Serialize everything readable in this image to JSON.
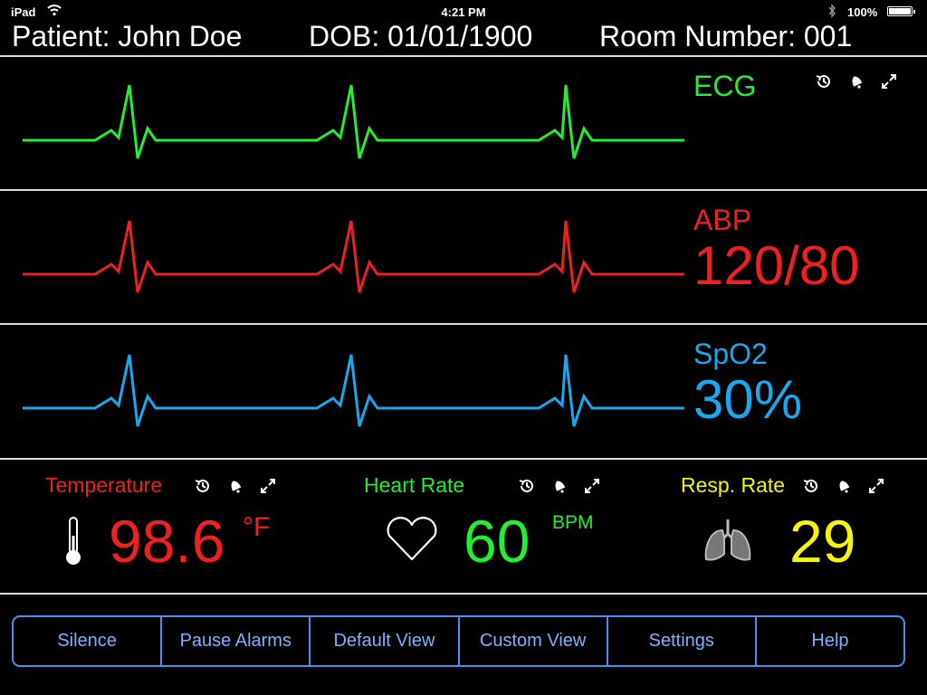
{
  "status_bar": {
    "carrier": "iPad",
    "time": "4:21 PM",
    "battery_percent": "100%"
  },
  "patient": {
    "name_text": "Patient: John Doe",
    "dob_text": "DOB: 01/01/1900",
    "room_text": "Room Number: 001"
  },
  "colors": {
    "ecg": "#22ee33",
    "abp": "#f02020",
    "spo2": "#19a8ef",
    "heart_rate": "#22ee33",
    "temperature": "#f02020",
    "resp_rate": "#f4f410",
    "button_text": "#7fb1ff",
    "button_border": "#4a8ef0"
  },
  "panels": {
    "ecg": {
      "label": "ECG",
      "icons": [
        "history-icon",
        "bell-icon",
        "expand-icon"
      ]
    },
    "abp": {
      "label": "ABP",
      "value": "120/80"
    },
    "spo2": {
      "label": "SpO2",
      "value": "30%"
    }
  },
  "vitals": {
    "temperature": {
      "label": "Temperature",
      "value": "98.6",
      "unit": "°F",
      "icon": "thermometer-icon"
    },
    "heart_rate": {
      "label": "Heart Rate",
      "value": "60",
      "unit": "BPM",
      "icon": "heart-icon"
    },
    "resp_rate": {
      "label": "Resp. Rate",
      "value": "29",
      "icon": "lungs-icon"
    }
  },
  "toolbar": {
    "buttons": [
      "Silence",
      "Pause Alarms",
      "Default View",
      "Custom View",
      "Settings",
      "Help"
    ]
  }
}
